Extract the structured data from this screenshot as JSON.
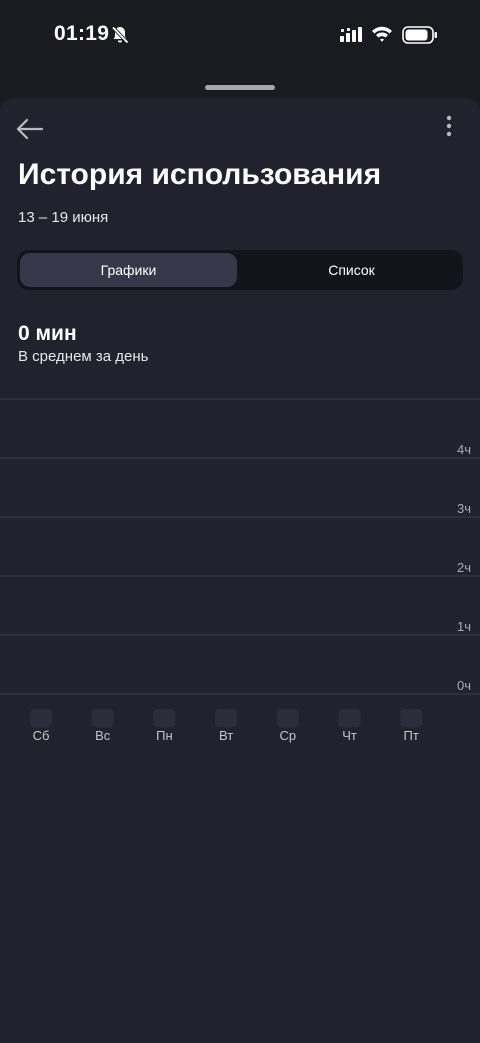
{
  "status_bar": {
    "time": "01:19",
    "icons": [
      "bell-slash-icon",
      "signal-icon",
      "wifi-icon",
      "battery-icon"
    ]
  },
  "header": {
    "back_icon": "arrow-left-icon",
    "more_icon": "more-vertical-icon",
    "title": "История использования",
    "date_range": "13 – 19 июня"
  },
  "segmented_control": {
    "options": [
      {
        "label": "Графики",
        "selected": true
      },
      {
        "label": "Список",
        "selected": false
      }
    ]
  },
  "summary": {
    "value": "0 мин",
    "label": "В среднем за день"
  },
  "chart_data": {
    "type": "bar",
    "categories": [
      "Сб",
      "Вс",
      "Пн",
      "Вт",
      "Ср",
      "Чт",
      "Пт"
    ],
    "values": [
      0,
      0,
      0,
      0,
      0,
      0,
      0
    ],
    "y_ticks": [
      "0ч",
      "1ч",
      "2ч",
      "3ч",
      "4ч"
    ],
    "ylim": [
      0,
      5
    ],
    "grid": true,
    "colors": {
      "grid": "#3b3d4c",
      "tick_text": "#a9aab2",
      "axis_text": "#c5c6cc"
    }
  },
  "colors": {
    "background": "#1a1b20",
    "sheet": "#21222e",
    "segmented_bg": "#13141b",
    "segment_selected": "#363849"
  }
}
